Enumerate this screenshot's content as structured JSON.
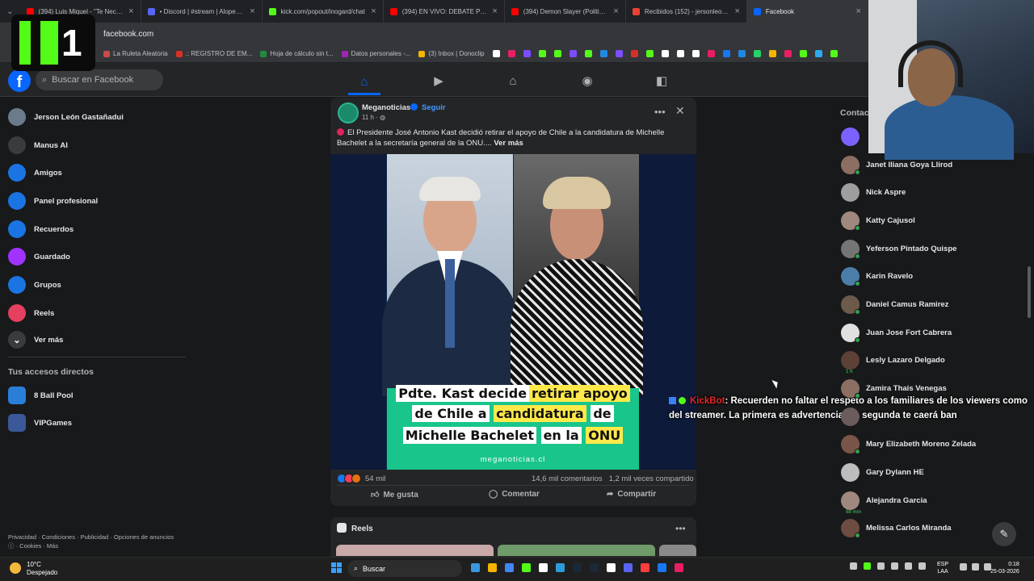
{
  "browser": {
    "tabs": [
      {
        "title": "(394) Luis Miquel - \"Te Necesito",
        "color": "#ff0000"
      },
      {
        "title": "• Discord | #stream | Alopecia A",
        "color": "#5865f2"
      },
      {
        "title": "kick.com/popout/inogard/chat",
        "color": "#53fc18"
      },
      {
        "title": "(394) EN VIVO: DEBATE PRESIDE",
        "color": "#ff0000"
      },
      {
        "title": "(394) Demon Slayer (Politicamente",
        "color": "#ff0000"
      },
      {
        "title": "Recibidos (152) - jersonleong@",
        "color": "#ea4335"
      },
      {
        "title": "Facebook",
        "color": "#0866ff",
        "active": true
      }
    ],
    "address": "facebook.com",
    "bookmarks": [
      {
        "label": "La Ruleta Aleatoria",
        "color": "#c94b4b"
      },
      {
        "label": ".: REGISTRO DE EM...",
        "color": "#d93025"
      },
      {
        "label": "Hoja de cálculo sin t...",
        "color": "#1e8e3e"
      },
      {
        "label": "Datos personales -...",
        "color": "#9c27b0"
      },
      {
        "label": "(3) Inbox | Donoclip",
        "color": "#f4b400"
      }
    ],
    "bookmark_icon_colors": [
      "#ffffff",
      "#e91e63",
      "#7c4dff",
      "#53fc18",
      "#53fc18",
      "#7c4dff",
      "#53fc18",
      "#1e88e5",
      "#7c4dff",
      "#d93025",
      "#53fc18",
      "#ffffff",
      "#ffffff",
      "#ffffff",
      "#e91e63",
      "#1877f2",
      "#1e88e5",
      "#25d366",
      "#f4b400",
      "#e91e63",
      "#53fc18",
      "#2aabee",
      "#53fc18"
    ]
  },
  "stream_overlay": {
    "logo_number": "1"
  },
  "facebook": {
    "search_placeholder": "Buscar en Facebook",
    "nav_icons": [
      "home-icon",
      "video-icon",
      "marketplace-icon",
      "groups-icon",
      "gaming-icon"
    ],
    "left_nav": [
      {
        "label": "Jerson León Gastañadui",
        "icon": "profile-avatar",
        "color": "#6b7b8c"
      },
      {
        "label": "Manus AI",
        "icon": "manus-icon",
        "color": "#3a3b3c"
      },
      {
        "label": "Amigos",
        "icon": "friends-icon",
        "color": "#1b74e4"
      },
      {
        "label": "Panel profesional",
        "icon": "dashboard-icon",
        "color": "#1b74e4"
      },
      {
        "label": "Recuerdos",
        "icon": "memories-icon",
        "color": "#1b74e4"
      },
      {
        "label": "Guardado",
        "icon": "saved-icon",
        "color": "#a033ff"
      },
      {
        "label": "Grupos",
        "icon": "groups-icon",
        "color": "#1b74e4"
      },
      {
        "label": "Reels",
        "icon": "reels-icon",
        "color": "#e4405f"
      },
      {
        "label": "Ver más",
        "icon": "chevron-down-icon",
        "color": "#3a3b3c"
      }
    ],
    "shortcuts_title": "Tus accesos directos",
    "shortcuts": [
      {
        "label": "8 Ball Pool",
        "color": "#2a7ed8"
      },
      {
        "label": "VIPGames",
        "color": "#3b5998"
      }
    ],
    "footer_links": "Privacidad · Condiciones · Publicidad · Opciones de anuncios",
    "footer_links2": "· Cookies · Más",
    "post": {
      "author": "Meganoticias",
      "follow": "Seguir",
      "time": "11 h ·",
      "text": "El Presidente José Antonio Kast decidió retirar el apoyo de Chile a la candidatura de Michelle Bachelet a la secretaría general de la ONU....",
      "see_more": "Ver más",
      "image_headline": {
        "line1_a": "Pdte. Kast decide",
        "line1_b": "retirar apoyo",
        "line2_a": "de Chile a",
        "line2_b": "candidatura",
        "line2_c": "de",
        "line3_a": "Michelle Bachelet",
        "line3_b": "en la",
        "line3_c": "ONU"
      },
      "image_url": "meganoticias.cl",
      "reactions_count": "54 mil",
      "comments": "14,6 mil comentarios",
      "shares": "1,2 mil veces compartido",
      "actions": {
        "like": "Me gusta",
        "comment": "Comentar",
        "share": "Compartir"
      }
    },
    "reels_title": "Reels",
    "contacts_title": "Contac",
    "contacts": [
      {
        "name": "",
        "color": "#7b61ff",
        "online": false
      },
      {
        "name": "Janet Iliana Goya Llirod",
        "color": "#8d6e63",
        "online": true
      },
      {
        "name": "Nick Aspre",
        "color": "#9e9e9e",
        "online": false
      },
      {
        "name": "Katty Cajusol",
        "color": "#a1887f",
        "online": true
      },
      {
        "name": "Yeferson Pintado Quispe",
        "color": "#757575",
        "online": true
      },
      {
        "name": "Karin Ravelo",
        "color": "#4a7ea8",
        "online": true
      },
      {
        "name": "Daniel Camus Ramirez",
        "color": "#6d5a4a",
        "online": true
      },
      {
        "name": "Juan Jose Fort Cabrera",
        "color": "#e0e0e0",
        "online": true
      },
      {
        "name": "Lesly Lazaro Delgado",
        "color": "#5d4037",
        "online": false,
        "mins": "1 h"
      },
      {
        "name": "Zamira Thais Venegas",
        "color": "#8d6e63",
        "online": true
      },
      {
        "name": "",
        "color": "#6b5b5b",
        "online": false
      },
      {
        "name": "Mary Elizabeth Moreno Zelada",
        "color": "#795548",
        "online": true
      },
      {
        "name": "Gary Dylann HE",
        "color": "#bdbdbd",
        "online": false
      },
      {
        "name": "Alejandra Garcia",
        "color": "#a1887f",
        "online": false,
        "mins": "58 min"
      },
      {
        "name": "Melissa Carlos Miranda",
        "color": "#6d4c41",
        "online": true
      }
    ]
  },
  "chat_overlay": {
    "user": "KickBot",
    "message": ": Recuerden no faltar el respeto a los familiares de los viewers como del streamer. La primera es advertencia. La segunda te caerá ban"
  },
  "taskbar": {
    "weather_temp": "10°C",
    "weather_desc": "Despejado",
    "search": "Buscar",
    "lang_line1": "ESP",
    "lang_line2": "LAA",
    "time": "0:18",
    "date": "25-03-2026",
    "app_icon_colors": [
      "#3a96dd",
      "#f4b400",
      "#4285f4",
      "#53fc18",
      "#ffffff",
      "#2d9cdb",
      "#1b2838",
      "#1b2838",
      "#ffffff",
      "#5865f2",
      "#ff3d3d",
      "#1877f2",
      "#e91e63"
    ]
  }
}
